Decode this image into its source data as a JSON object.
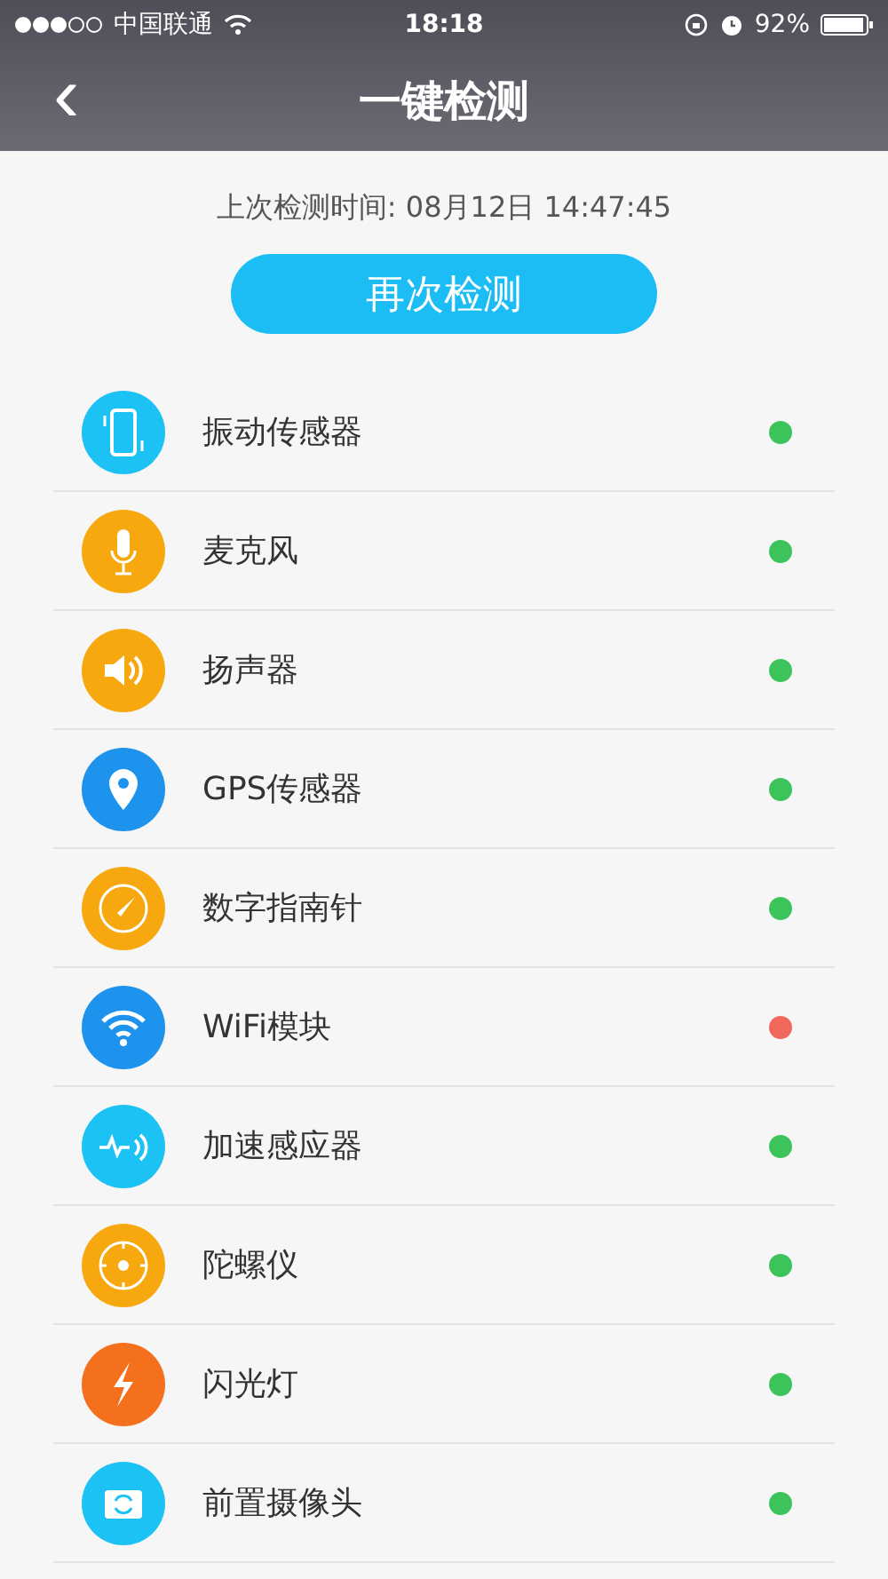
{
  "status_bar": {
    "carrier": "中国联通",
    "time": "18:18",
    "battery": "92%"
  },
  "header": {
    "back": "‹",
    "title": "一键检测"
  },
  "last_check": "上次检测时间: 08月12日 14:47:45",
  "recheck_button": "再次检测",
  "sensors": [
    {
      "kind": "vibration",
      "label": "振动传感器",
      "color": "#3cc35a"
    },
    {
      "kind": "microphone",
      "label": "麦克风",
      "color": "#3cc35a"
    },
    {
      "kind": "speaker",
      "label": "扬声器",
      "color": "#3cc35a"
    },
    {
      "kind": "gps",
      "label": "GPS传感器",
      "color": "#3cc35a"
    },
    {
      "kind": "compass",
      "label": "数字指南针",
      "color": "#3cc35a"
    },
    {
      "kind": "wifi",
      "label": "WiFi模块",
      "color": "#f0685c"
    },
    {
      "kind": "accelerometer",
      "label": "加速感应器",
      "color": "#3cc35a"
    },
    {
      "kind": "gyroscope",
      "label": "陀螺仪",
      "color": "#3cc35a"
    },
    {
      "kind": "flash",
      "label": "闪光灯",
      "color": "#3cc35a"
    },
    {
      "kind": "camera",
      "label": "前置摄像头",
      "color": "#3cc35a"
    }
  ]
}
